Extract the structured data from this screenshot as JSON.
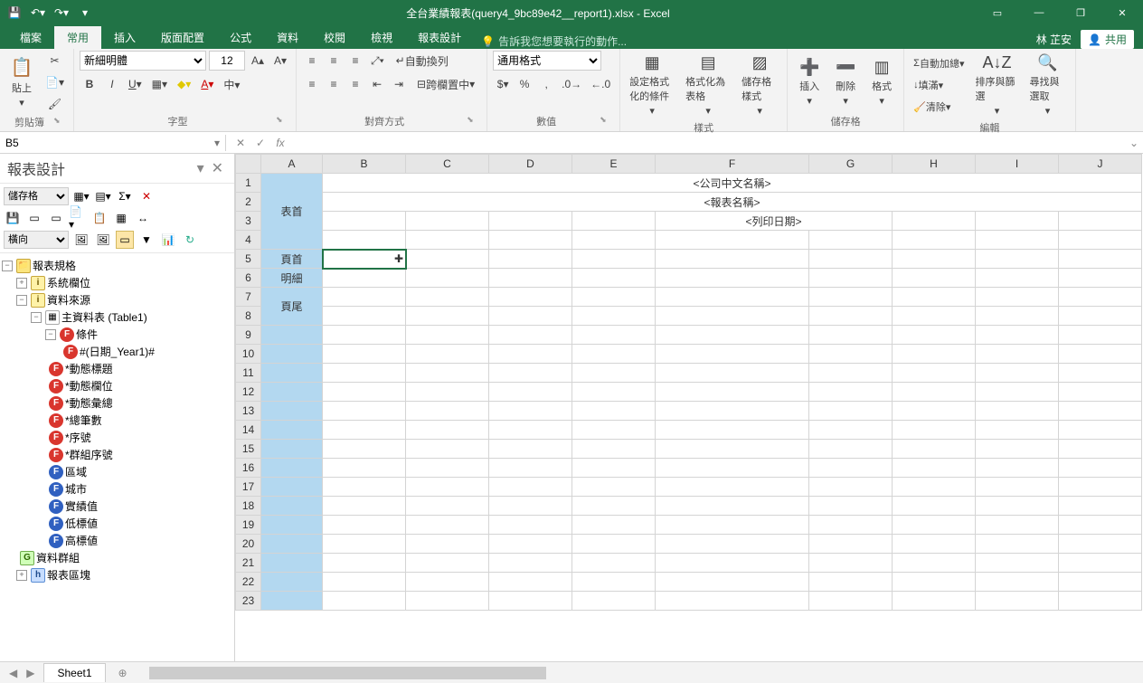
{
  "titlebar": {
    "doc_title": "全台業績報表(query4_9bc89e42__report1).xlsx - Excel",
    "user": "林 芷安",
    "share": "共用"
  },
  "tabs": {
    "file": "檔案",
    "home": "常用",
    "insert": "插入",
    "layout": "版面配置",
    "formulas": "公式",
    "data": "資料",
    "review": "校閱",
    "view": "檢視",
    "report": "報表設計",
    "tellme": "告訴我您想要執行的動作..."
  },
  "ribbon": {
    "clipboard": {
      "paste": "貼上",
      "label": "剪貼簿"
    },
    "font": {
      "name": "新細明體",
      "size": "12",
      "label": "字型"
    },
    "align": {
      "wrap": "自動換列",
      "merge": "跨欄置中",
      "label": "對齊方式"
    },
    "number": {
      "format": "通用格式",
      "label": "數值"
    },
    "styles": {
      "cond": "設定格式化的條件",
      "table": "格式化為表格",
      "cell": "儲存格樣式",
      "label": "樣式"
    },
    "cells": {
      "insert": "插入",
      "delete": "刪除",
      "format": "格式",
      "label": "儲存格"
    },
    "editing": {
      "sum": "自動加總",
      "fill": "填滿",
      "clear": "清除",
      "sort": "排序與篩選",
      "find": "尋找與選取",
      "label": "編輯"
    }
  },
  "fx": {
    "cell_ref": "B5",
    "formula": ""
  },
  "leftpane": {
    "title": "報表設計",
    "select1": "儲存格",
    "select2": "橫向",
    "tree": {
      "root": "報表規格",
      "sys": "系統欄位",
      "src": "資料來源",
      "main_table": "主資料表 (Table1)",
      "cond": "條件",
      "cond_item": "#(日期_Year1)#",
      "dyn_title": "*動態標題",
      "dyn_col": "*動態欄位",
      "dyn_sum": "*動態彙總",
      "count": "*總筆數",
      "seq": "*序號",
      "grp_seq": "*群組序號",
      "region": "區域",
      "city": "城市",
      "actual": "實績值",
      "low": "低標値",
      "high": "高標値",
      "grp": "資料群組",
      "block": "報表區塊"
    }
  },
  "grid": {
    "columns": [
      "A",
      "B",
      "C",
      "D",
      "E",
      "F",
      "G",
      "H",
      "I",
      "J"
    ],
    "rows": 23,
    "colA": {
      "r1_4": "表首",
      "r5": "頁首",
      "r6": "明細",
      "r7_8": "頁尾"
    },
    "content": {
      "company": "<公司中文名稱>",
      "report": "<報表名稱>",
      "print_date": "<列印日期>"
    }
  },
  "sheet": {
    "name": "Sheet1"
  }
}
